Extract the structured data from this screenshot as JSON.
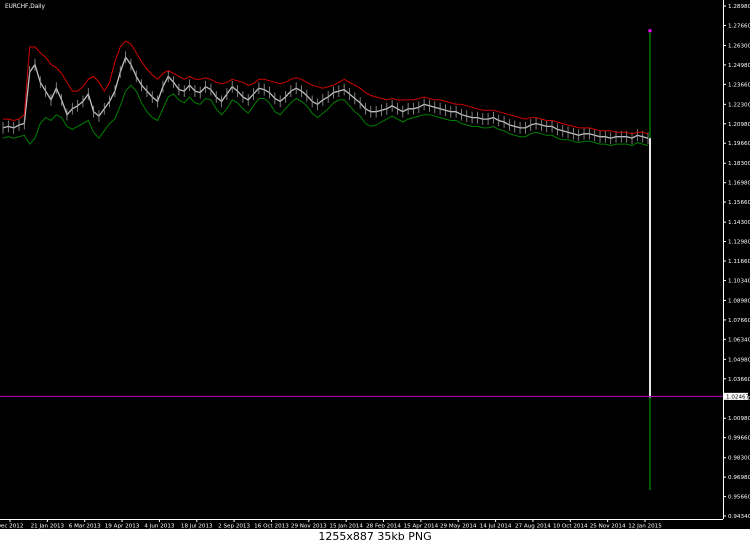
{
  "chart_data": {
    "type": "line",
    "title": "EURCHF,Daily",
    "symbol": "EURCHF",
    "timeframe": "Daily",
    "current_price_label": "1.02467",
    "ylim": [
      0.9434,
      1.2898
    ],
    "y_ticks": [
      "1.28980",
      "1.27660",
      "1.26300",
      "1.24980",
      "1.23660",
      "1.22300",
      "1.20980",
      "1.19660",
      "1.18300",
      "1.16980",
      "1.15660",
      "1.14300",
      "1.12980",
      "1.11660",
      "1.10340",
      "1.08980",
      "1.07660",
      "1.06340",
      "1.04980",
      "1.03660",
      "1.02340",
      "1.00980",
      "0.99660",
      "0.98300",
      "0.96980",
      "0.95660",
      "0.94340"
    ],
    "x_ticks": [
      "Dec 2012",
      "21 Jan 2013",
      "6 Mar 2013",
      "19 Apr 2013",
      "4 Jun 2013",
      "18 Jul 2013",
      "2 Sep 2013",
      "16 Oct 2013",
      "29 Nov 2013",
      "15 Jan 2014",
      "28 Feb 2014",
      "15 Apr 2014",
      "29 May 2014",
      "14 Jul 2014",
      "27 Aug 2014",
      "10 Oct 2014",
      "25 Nov 2014",
      "12 Jan 2015"
    ],
    "series": [
      {
        "role": "price",
        "values": [
          1.207,
          1.208,
          1.207,
          1.209,
          1.21,
          1.245,
          1.25,
          1.238,
          1.232,
          1.226,
          1.234,
          1.226,
          1.216,
          1.22,
          1.222,
          1.225,
          1.23,
          1.218,
          1.215,
          1.22,
          1.225,
          1.232,
          1.245,
          1.255,
          1.25,
          1.242,
          1.236,
          1.232,
          1.228,
          1.225,
          1.235,
          1.242,
          1.238,
          1.233,
          1.232,
          1.236,
          1.232,
          1.231,
          1.235,
          1.233,
          1.228,
          1.225,
          1.23,
          1.235,
          1.232,
          1.228,
          1.226,
          1.23,
          1.234,
          1.233,
          1.231,
          1.227,
          1.225,
          1.228,
          1.232,
          1.234,
          1.232,
          1.229,
          1.225,
          1.223,
          1.226,
          1.228,
          1.231,
          1.232,
          1.233,
          1.23,
          1.227,
          1.224,
          1.22,
          1.218,
          1.218,
          1.219,
          1.22,
          1.222,
          1.22,
          1.218,
          1.22,
          1.22,
          1.221,
          1.223,
          1.222,
          1.221,
          1.22,
          1.219,
          1.218,
          1.218,
          1.216,
          1.215,
          1.214,
          1.214,
          1.213,
          1.213,
          1.214,
          1.212,
          1.211,
          1.209,
          1.208,
          1.207,
          1.207,
          1.209,
          1.21,
          1.209,
          1.208,
          1.208,
          1.206,
          1.205,
          1.204,
          1.203,
          1.202,
          1.203,
          1.203,
          1.202,
          1.201,
          1.201,
          1.2,
          1.201,
          1.201,
          1.201,
          1.2,
          1.202,
          1.201,
          1.2
        ]
      },
      {
        "role": "upper-band",
        "color": "#d00000",
        "values": [
          1.213,
          1.213,
          1.212,
          1.213,
          1.216,
          1.262,
          1.262,
          1.258,
          1.255,
          1.25,
          1.248,
          1.244,
          1.238,
          1.232,
          1.232,
          1.235,
          1.24,
          1.242,
          1.238,
          1.232,
          1.238,
          1.252,
          1.262,
          1.266,
          1.264,
          1.258,
          1.252,
          1.247,
          1.243,
          1.24,
          1.244,
          1.246,
          1.244,
          1.242,
          1.24,
          1.242,
          1.24,
          1.24,
          1.241,
          1.24,
          1.238,
          1.237,
          1.238,
          1.24,
          1.239,
          1.238,
          1.236,
          1.237,
          1.24,
          1.24,
          1.239,
          1.238,
          1.237,
          1.238,
          1.24,
          1.241,
          1.24,
          1.238,
          1.236,
          1.235,
          1.234,
          1.235,
          1.236,
          1.238,
          1.24,
          1.238,
          1.236,
          1.234,
          1.231,
          1.229,
          1.228,
          1.227,
          1.226,
          1.227,
          1.226,
          1.226,
          1.226,
          1.226,
          1.227,
          1.228,
          1.227,
          1.226,
          1.226,
          1.225,
          1.224,
          1.223,
          1.223,
          1.222,
          1.221,
          1.22,
          1.219,
          1.219,
          1.219,
          1.218,
          1.217,
          1.216,
          1.215,
          1.214,
          1.213,
          1.214,
          1.214,
          1.213,
          1.212,
          1.212,
          1.211,
          1.21,
          1.209,
          1.208,
          1.207,
          1.207,
          1.207,
          1.206,
          1.205,
          1.205,
          1.205,
          1.204,
          1.204,
          1.204,
          1.203,
          1.204,
          1.204,
          1.203
        ]
      },
      {
        "role": "lower-band",
        "color": "#008000",
        "values": [
          1.2,
          1.201,
          1.2,
          1.201,
          1.202,
          1.196,
          1.2,
          1.21,
          1.214,
          1.212,
          1.216,
          1.214,
          1.208,
          1.206,
          1.208,
          1.21,
          1.212,
          1.204,
          1.2,
          1.205,
          1.21,
          1.213,
          1.222,
          1.232,
          1.236,
          1.232,
          1.224,
          1.218,
          1.214,
          1.212,
          1.22,
          1.228,
          1.23,
          1.226,
          1.224,
          1.228,
          1.224,
          1.223,
          1.227,
          1.226,
          1.22,
          1.216,
          1.22,
          1.226,
          1.224,
          1.22,
          1.217,
          1.222,
          1.227,
          1.227,
          1.224,
          1.218,
          1.216,
          1.22,
          1.224,
          1.227,
          1.225,
          1.222,
          1.217,
          1.214,
          1.217,
          1.22,
          1.224,
          1.226,
          1.226,
          1.222,
          1.218,
          1.215,
          1.21,
          1.208,
          1.209,
          1.211,
          1.213,
          1.215,
          1.213,
          1.211,
          1.213,
          1.214,
          1.215,
          1.216,
          1.216,
          1.215,
          1.214,
          1.213,
          1.212,
          1.212,
          1.21,
          1.209,
          1.208,
          1.208,
          1.207,
          1.207,
          1.208,
          1.206,
          1.205,
          1.203,
          1.202,
          1.201,
          1.201,
          1.203,
          1.204,
          1.203,
          1.202,
          1.202,
          1.2,
          1.199,
          1.199,
          1.198,
          1.197,
          1.198,
          1.198,
          1.197,
          1.196,
          1.196,
          1.195,
          1.196,
          1.196,
          1.196,
          1.195,
          1.197,
          1.196,
          1.195
        ]
      }
    ],
    "final_candle": {
      "open": 1.2,
      "high": 1.272,
      "low": 0.961,
      "close": 1.024
    },
    "price_line": 1.02467,
    "grid": false,
    "legend": "none"
  },
  "caption": "1255x887 35kb PNG"
}
